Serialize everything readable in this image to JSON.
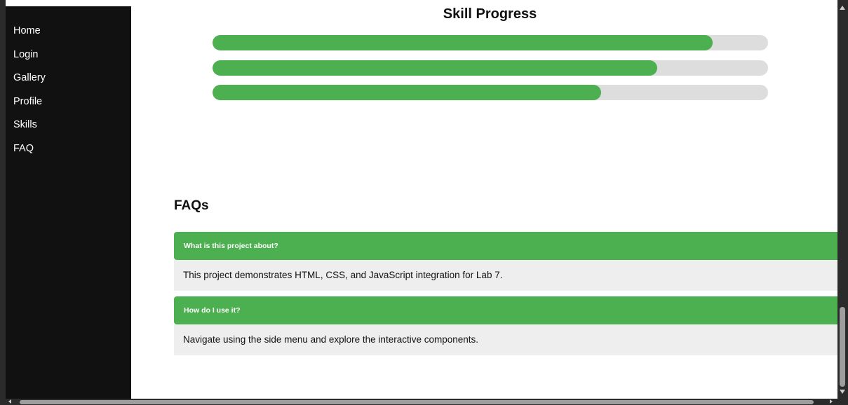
{
  "sidebar": {
    "items": [
      {
        "label": "Home"
      },
      {
        "label": "Login"
      },
      {
        "label": "Gallery"
      },
      {
        "label": "Profile"
      },
      {
        "label": "Skills"
      },
      {
        "label": "FAQ"
      }
    ]
  },
  "skills": {
    "title": "Skill Progress",
    "bars": [
      {
        "percent": 90
      },
      {
        "percent": 80
      },
      {
        "percent": 70
      }
    ]
  },
  "faq": {
    "title": "FAQs",
    "items": [
      {
        "question": "What is this project about?",
        "answer": "This project demonstrates HTML, CSS, and JavaScript integration for Lab 7."
      },
      {
        "question": "How do I use it?",
        "answer": "Navigate using the side menu and explore the interactive components."
      }
    ]
  },
  "colors": {
    "accent": "#4caf50",
    "sidebar_bg": "#111111",
    "track": "#dddddd",
    "answer_bg": "#eeeeee"
  }
}
